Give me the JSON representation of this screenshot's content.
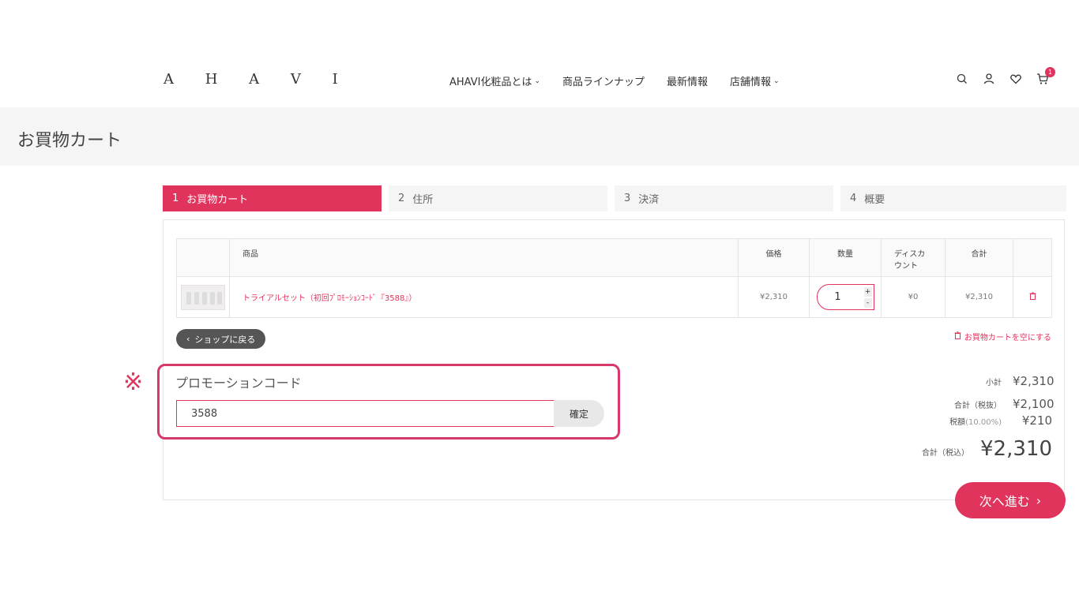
{
  "header": {
    "logo": "A H A V I",
    "nav": [
      {
        "label": "AHAVI化粧品とは",
        "dropdown": true
      },
      {
        "label": "商品ラインナップ",
        "dropdown": false
      },
      {
        "label": "最新情報",
        "dropdown": false
      },
      {
        "label": "店舗情報",
        "dropdown": true
      }
    ],
    "icons": [
      "search-icon",
      "user-icon",
      "heart-icon",
      "cart-icon"
    ],
    "cart_count": "1"
  },
  "page": {
    "title": "お買物カート"
  },
  "steps": [
    {
      "num": "1",
      "label": "お買物カート",
      "active": true
    },
    {
      "num": "2",
      "label": "住所",
      "active": false
    },
    {
      "num": "3",
      "label": "決済",
      "active": false
    },
    {
      "num": "4",
      "label": "概要",
      "active": false
    }
  ],
  "table": {
    "headers": {
      "product": "商品",
      "price": "価格",
      "qty": "数量",
      "discount": "ディスカ\nウント",
      "total": "合計"
    },
    "rows": [
      {
        "name": "トライアルセット（初回ﾌﾟﾛﾓｰｼｮﾝｺｰﾄﾞ『3588』）",
        "price": "¥2,310",
        "qty": "1",
        "discount": "¥0",
        "total": "¥2,310"
      }
    ]
  },
  "actions": {
    "back": "ショップに戻る",
    "empty_cart": "お買物カートを空にする"
  },
  "promo": {
    "marker": "※",
    "label": "プロモーションコード",
    "value": "3588",
    "button": "確定"
  },
  "totals": {
    "subtotal_label": "小計",
    "subtotal": "¥2,310",
    "pretax_label": "合計（税抜）",
    "pretax": "¥2,100",
    "tax_label": "税額",
    "tax_rate": "(10.00%)",
    "tax": "¥210",
    "grand_label": "合計（税込）",
    "grand": "¥2,310"
  },
  "next_button": "次へ進む",
  "colors": {
    "accent": "#e0345c",
    "highlight_border": "#d6386a"
  }
}
